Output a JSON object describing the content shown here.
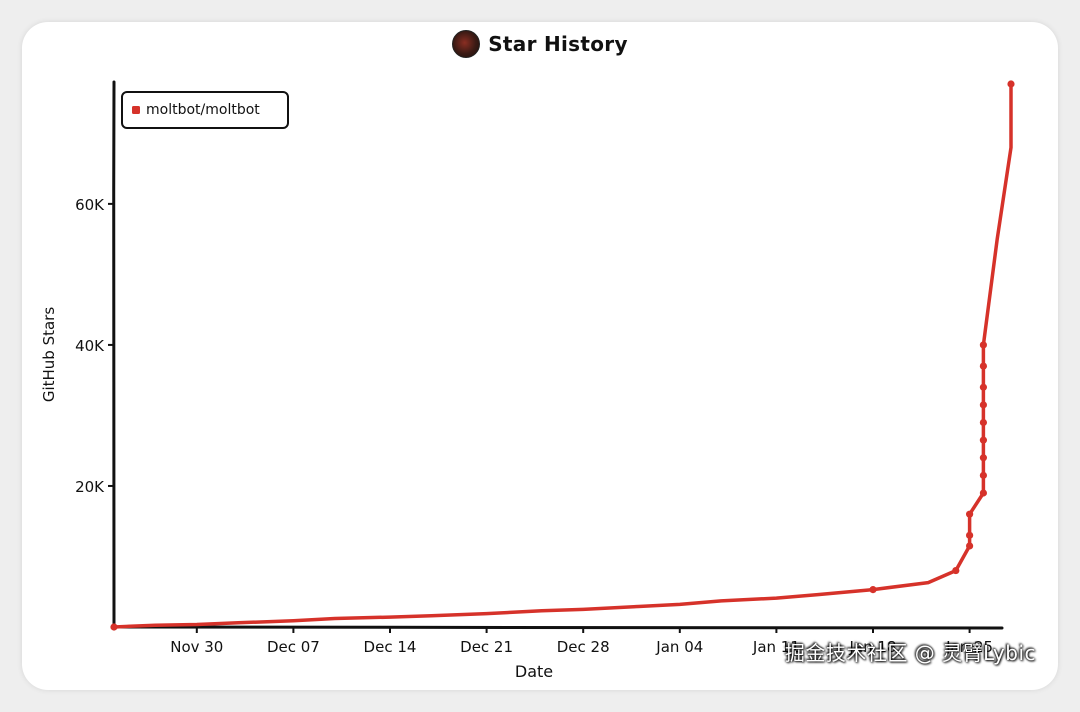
{
  "title": "Star History",
  "watermark": "掘金技术社区 @ 灵臂Lybic",
  "colors": {
    "series": "#d6322a",
    "axis": "#111111"
  },
  "chart_data": {
    "type": "line",
    "title": "Star History",
    "xlabel": "Date",
    "ylabel": "GitHub Stars",
    "x_ticks": [
      "Nov 30",
      "Dec 07",
      "Dec 14",
      "Dec 21",
      "Dec 28",
      "Jan 04",
      "Jan 11",
      "Jan 18",
      "Jan 25"
    ],
    "y_ticks": [
      "20K",
      "40K",
      "60K"
    ],
    "ylim": [
      0,
      77000
    ],
    "legend_position": "top-left",
    "series": [
      {
        "name": "moltbot/moltbot",
        "color": "#d6322a",
        "points": [
          {
            "x": "2025-11-24",
            "y": 0
          },
          {
            "x": "2025-11-27",
            "y": 250
          },
          {
            "x": "2025-11-30",
            "y": 350
          },
          {
            "x": "2025-12-03",
            "y": 600
          },
          {
            "x": "2025-12-07",
            "y": 900
          },
          {
            "x": "2025-12-10",
            "y": 1200
          },
          {
            "x": "2025-12-14",
            "y": 1400
          },
          {
            "x": "2025-12-17",
            "y": 1600
          },
          {
            "x": "2025-12-21",
            "y": 1900
          },
          {
            "x": "2025-12-25",
            "y": 2300
          },
          {
            "x": "2025-12-28",
            "y": 2500
          },
          {
            "x": "2026-01-01",
            "y": 2900
          },
          {
            "x": "2026-01-04",
            "y": 3200
          },
          {
            "x": "2026-01-07",
            "y": 3700
          },
          {
            "x": "2026-01-11",
            "y": 4100
          },
          {
            "x": "2026-01-14",
            "y": 4600
          },
          {
            "x": "2026-01-18",
            "y": 5300
          },
          {
            "x": "2026-01-22",
            "y": 6300
          },
          {
            "x": "2026-01-24",
            "y": 8000
          },
          {
            "x": "2026-01-25",
            "y": 11500
          },
          {
            "x": "2026-01-25",
            "y": 13000
          },
          {
            "x": "2026-01-25",
            "y": 16000
          },
          {
            "x": "2026-01-26",
            "y": 19000
          },
          {
            "x": "2026-01-26",
            "y": 21500
          },
          {
            "x": "2026-01-26",
            "y": 24000
          },
          {
            "x": "2026-01-26",
            "y": 26500
          },
          {
            "x": "2026-01-26",
            "y": 29000
          },
          {
            "x": "2026-01-26",
            "y": 31500
          },
          {
            "x": "2026-01-26",
            "y": 34000
          },
          {
            "x": "2026-01-26",
            "y": 37000
          },
          {
            "x": "2026-01-26",
            "y": 40000
          },
          {
            "x": "2026-01-27",
            "y": 55000
          },
          {
            "x": "2026-01-28",
            "y": 68000
          },
          {
            "x": "2026-01-28",
            "y": 77000
          }
        ]
      }
    ],
    "markers": [
      {
        "x": "2025-11-24",
        "y": 0
      },
      {
        "x": "2026-01-18",
        "y": 5300
      },
      {
        "x": "2026-01-24",
        "y": 8000
      },
      {
        "x": "2026-01-25",
        "y": 11500
      },
      {
        "x": "2026-01-25",
        "y": 13000
      },
      {
        "x": "2026-01-25",
        "y": 16000
      },
      {
        "x": "2026-01-26",
        "y": 19000
      },
      {
        "x": "2026-01-26",
        "y": 21500
      },
      {
        "x": "2026-01-26",
        "y": 24000
      },
      {
        "x": "2026-01-26",
        "y": 26500
      },
      {
        "x": "2026-01-26",
        "y": 29000
      },
      {
        "x": "2026-01-26",
        "y": 31500
      },
      {
        "x": "2026-01-26",
        "y": 34000
      },
      {
        "x": "2026-01-26",
        "y": 37000
      },
      {
        "x": "2026-01-26",
        "y": 40000
      },
      {
        "x": "2026-01-28",
        "y": 77000
      }
    ]
  }
}
